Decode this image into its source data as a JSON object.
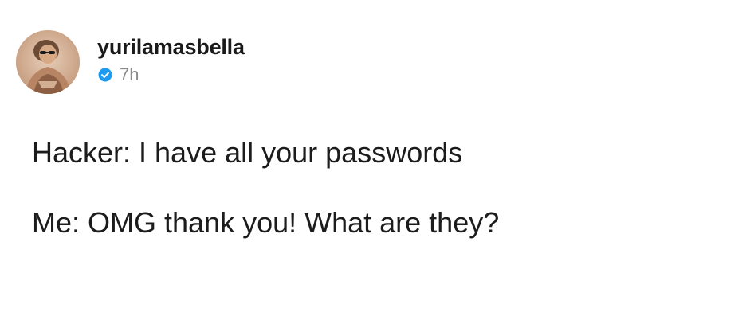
{
  "post": {
    "author": {
      "username": "yurilamasbella",
      "verified_icon": "verified-badge-icon",
      "time": "7h"
    },
    "lines": [
      "Hacker: I have all your passwords",
      "Me: OMG thank you! What are they?"
    ]
  },
  "colors": {
    "background": "#ffffff",
    "text": "#1c1c1c",
    "muted": "#8a8a8a",
    "verified": "#1d9bf0"
  }
}
